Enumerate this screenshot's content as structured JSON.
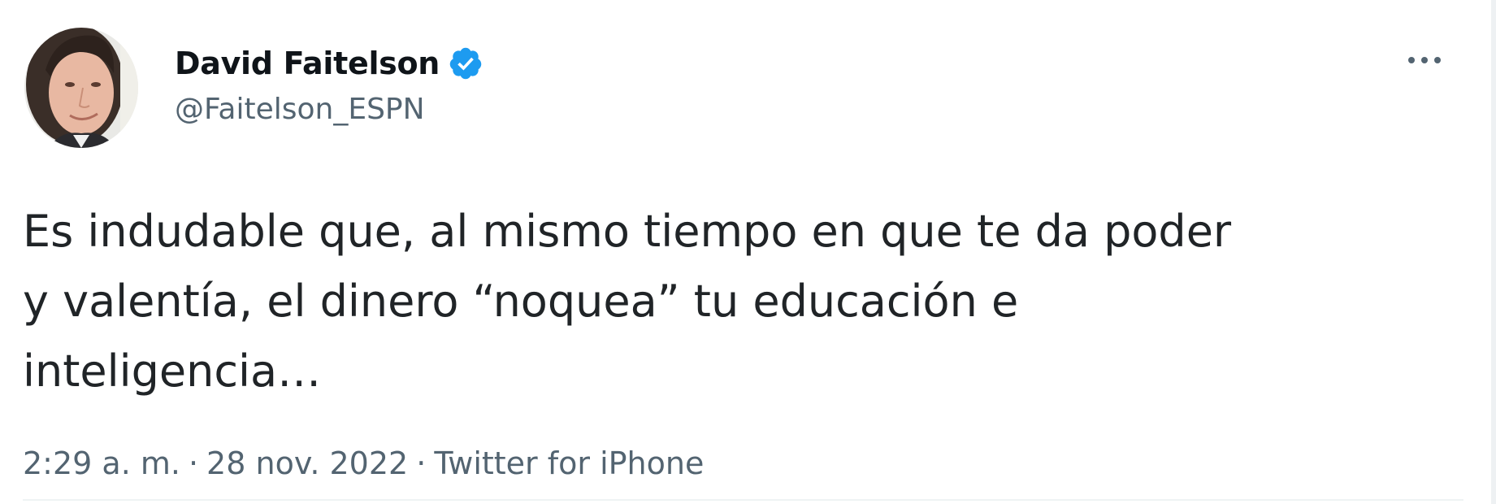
{
  "author": {
    "display_name": "David Faitelson",
    "handle": "@Faitelson_ESPN",
    "verified": true,
    "verified_icon": "verified-badge-icon",
    "avatar_icon": "profile-photo"
  },
  "more_icon": "ellipsis-icon",
  "tweet": {
    "lines": [
      "Es indudable que, al mismo tiempo en que te da poder",
      "y valentía, el dinero “noquea” tu educación e",
      "inteligencia…"
    ]
  },
  "meta": {
    "time": "2:29 a. m.",
    "separator": "·",
    "date": "28 nov. 2022",
    "source": "Twitter for iPhone"
  },
  "colors": {
    "text": "#0f1419",
    "secondary": "#536471",
    "verified": "#1d9bf0"
  }
}
